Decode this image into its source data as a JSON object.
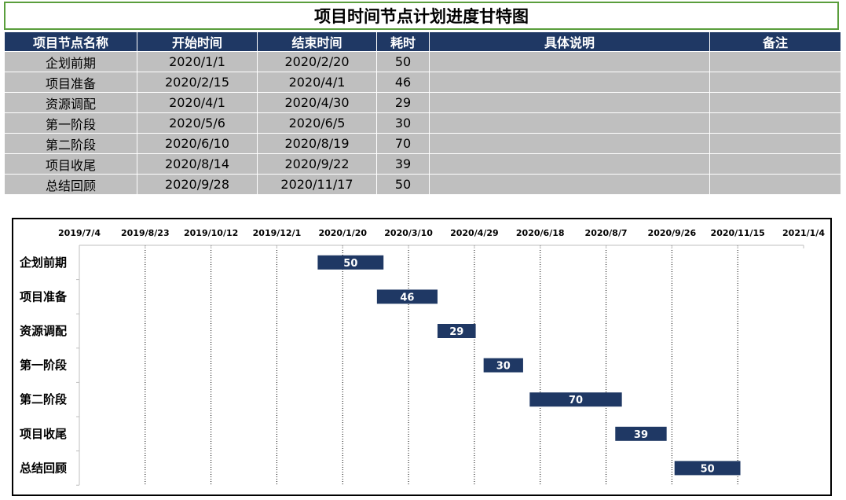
{
  "title": "项目时间节点计划进度甘特图",
  "table": {
    "headers": [
      "项目节点名称",
      "开始时间",
      "结束时间",
      "耗时",
      "具体说明",
      "备注"
    ],
    "rows": [
      [
        "企划前期",
        "2020/1/1",
        "2020/2/20",
        "50",
        "",
        ""
      ],
      [
        "项目准备",
        "2020/2/15",
        "2020/4/1",
        "46",
        "",
        ""
      ],
      [
        "资源调配",
        "2020/4/1",
        "2020/4/30",
        "29",
        "",
        ""
      ],
      [
        "第一阶段",
        "2020/5/6",
        "2020/6/5",
        "30",
        "",
        ""
      ],
      [
        "第二阶段",
        "2020/6/10",
        "2020/8/19",
        "70",
        "",
        ""
      ],
      [
        "项目收尾",
        "2020/8/14",
        "2020/9/22",
        "39",
        "",
        ""
      ],
      [
        "总结回顾",
        "2020/9/28",
        "2020/11/17",
        "50",
        "",
        ""
      ]
    ]
  },
  "colors": {
    "bar": "#1f3864",
    "header_bg": "#1f3864",
    "cell_bg": "#bfbfbf",
    "title_border": "#5a9e3c"
  },
  "chart_data": {
    "type": "bar",
    "orientation": "horizontal-gantt",
    "categories": [
      "企划前期",
      "项目准备",
      "资源调配",
      "第一阶段",
      "第二阶段",
      "项目收尾",
      "总结回顾"
    ],
    "start": [
      "2020-01-01",
      "2020-02-15",
      "2020-04-01",
      "2020-05-06",
      "2020-06-10",
      "2020-08-14",
      "2020-09-28"
    ],
    "values": [
      50,
      46,
      29,
      30,
      70,
      39,
      50
    ],
    "x_ticks": [
      "2019/7/4",
      "2019/8/23",
      "2019/10/12",
      "2019/12/1",
      "2020/1/20",
      "2020/3/10",
      "2020/4/29",
      "2020/6/18",
      "2020/8/7",
      "2020/9/26",
      "2020/11/15",
      "2021/1/4"
    ],
    "xlim": [
      "2019-07-04",
      "2021-01-04"
    ],
    "x_axis_position": "top",
    "grid": "vertical-dotted",
    "legend": "none"
  }
}
